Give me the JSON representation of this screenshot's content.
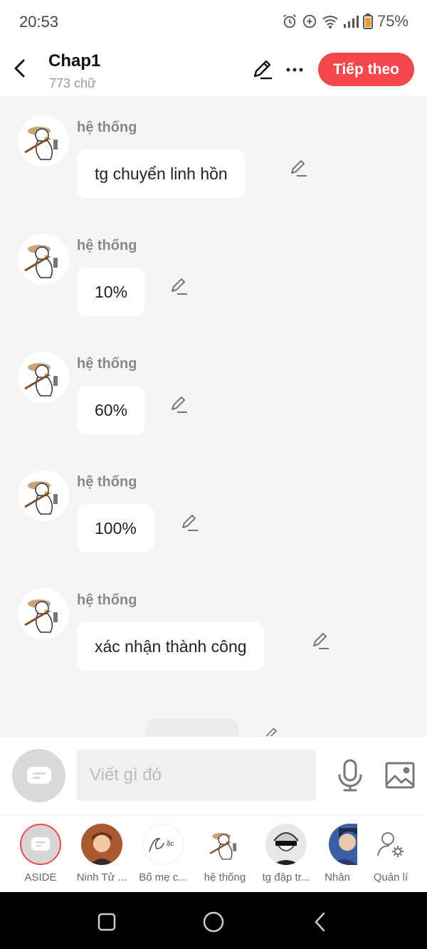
{
  "status_bar": {
    "time": "20:53",
    "battery": "75%",
    "icons": [
      "alarm-icon",
      "data-saver-icon",
      "wifi-icon",
      "signal-icon",
      "battery-icon"
    ]
  },
  "header": {
    "title": "Chap1",
    "word_count": "773 chữ",
    "next_label": "Tiếp theo",
    "accent_color": "#f2474c"
  },
  "messages": [
    {
      "sender": "hệ thống",
      "text": "tg chuyển linh hồn"
    },
    {
      "sender": "hệ thống",
      "text": "10%"
    },
    {
      "sender": "hệ thống",
      "text": "60%"
    },
    {
      "sender": "hệ thống",
      "text": "100%"
    },
    {
      "sender": "hệ thống",
      "text": "xác nhận thành công"
    }
  ],
  "composer": {
    "placeholder": "Viết gì đó"
  },
  "characters": [
    {
      "name": "ASIDE"
    },
    {
      "name": "Ninh Tử ..."
    },
    {
      "name": "Bố mẹ c..."
    },
    {
      "name": "hệ thống"
    },
    {
      "name": "tg đập tr..."
    },
    {
      "name": "Nhân"
    },
    {
      "name": "Quản lí"
    }
  ]
}
